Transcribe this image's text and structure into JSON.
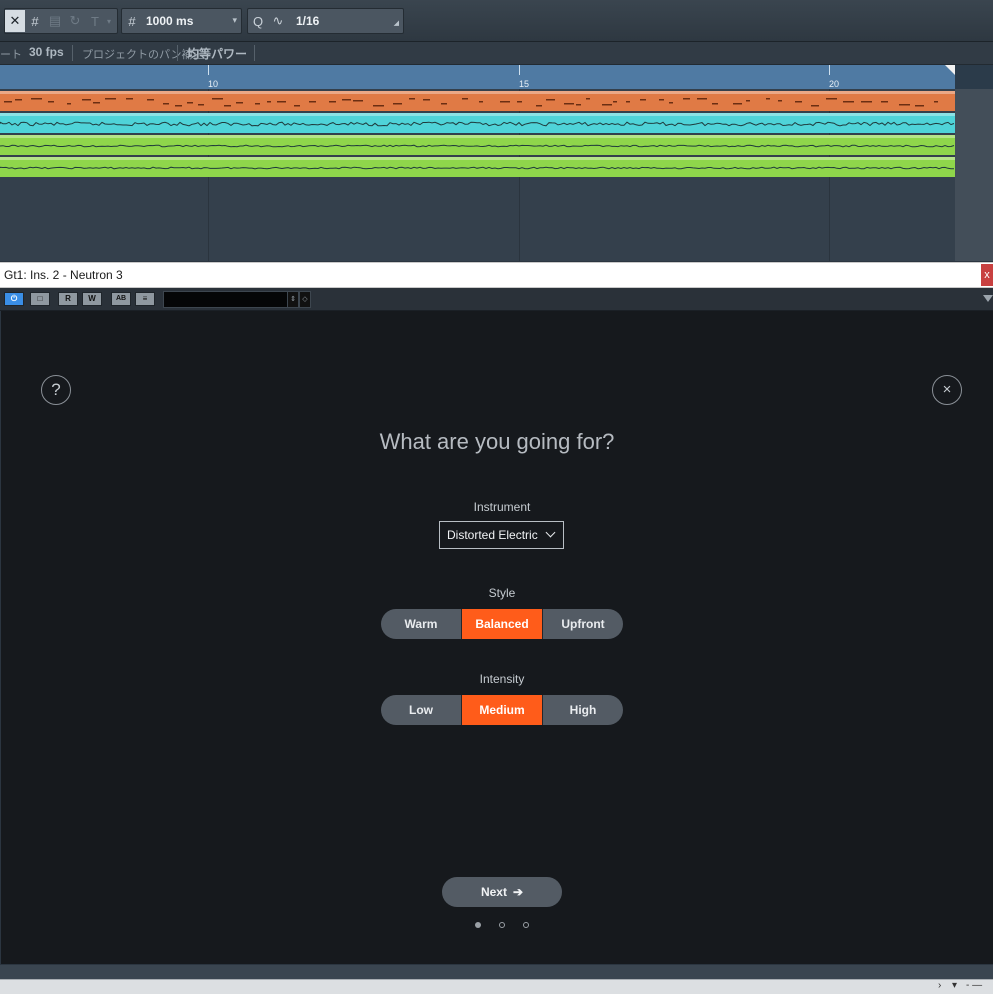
{
  "toolbar": {
    "nudge_value": "1000 ms",
    "quantize_value": "1/16"
  },
  "subbar": {
    "prefix_fragment": "ート",
    "frame_rate": "30 fps",
    "pan_compensation_label": "プロジェクトのパン補正",
    "pan_law_value": "均等パワー"
  },
  "ruler": {
    "marks": [
      "10",
      "15",
      "20"
    ]
  },
  "plugin_window": {
    "title": "Gt1: Ins. 2 - Neutron 3",
    "close_glyph": "x",
    "buttons": {
      "read": "R",
      "write": "W",
      "ab": "AB"
    }
  },
  "assistant": {
    "help_glyph": "?",
    "close_glyph": "×",
    "question": "What are you going for?",
    "instrument": {
      "label": "Instrument",
      "selected": "Distorted Electric"
    },
    "style": {
      "label": "Style",
      "options": [
        "Warm",
        "Balanced",
        "Upfront"
      ],
      "selected": "Balanced"
    },
    "intensity": {
      "label": "Intensity",
      "options": [
        "Low",
        "Medium",
        "High"
      ],
      "selected": "Medium"
    },
    "next_label": "Next",
    "page_indicator": {
      "current": 1,
      "total": 3
    },
    "accent_color": "#ff5c1a"
  },
  "tracks": [
    {
      "color": "#e07a45"
    },
    {
      "color": "#4fd3d8"
    },
    {
      "color": "#8fd64b"
    },
    {
      "color": "#8fd64b"
    }
  ]
}
